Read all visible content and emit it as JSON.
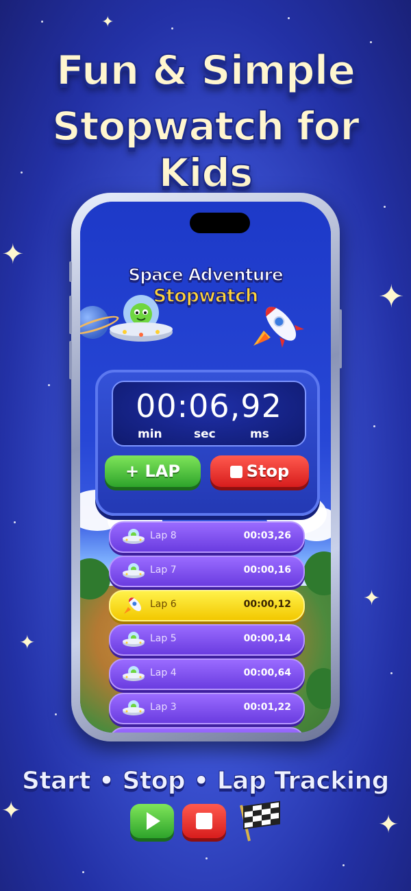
{
  "headline": {
    "line1": "Fun & Simple",
    "line2": "Stopwatch for Kids"
  },
  "app": {
    "title_line1": "Space Adventure",
    "title_line2": "Stopwatch"
  },
  "timer": {
    "display": "00:06,92",
    "units": [
      "min",
      "sec",
      "ms"
    ]
  },
  "buttons": {
    "lap_label": "+ LAP",
    "stop_label": "Stop"
  },
  "laps": [
    {
      "name": "Lap 8",
      "time": "00:03,26",
      "icon": "ufo-icon",
      "highlight": false
    },
    {
      "name": "Lap 7",
      "time": "00:00,16",
      "icon": "ufo-icon",
      "highlight": false
    },
    {
      "name": "Lap 6",
      "time": "00:00,12",
      "icon": "rocket-icon",
      "highlight": true
    },
    {
      "name": "Lap 5",
      "time": "00:00,14",
      "icon": "ufo-icon",
      "highlight": false
    },
    {
      "name": "Lap 4",
      "time": "00:00,64",
      "icon": "ufo-icon",
      "highlight": false
    },
    {
      "name": "Lap 3",
      "time": "00:01,22",
      "icon": "ufo-icon",
      "highlight": false
    }
  ],
  "features": "Start • Stop • Lap Tracking",
  "feature_icons": [
    "play-icon",
    "stop-icon",
    "checkered-flag-icon"
  ],
  "colors": {
    "lap_purple": "#7b4cf0",
    "lap_highlight": "#f7d21a",
    "lap_button": "#3cb935",
    "stop_button": "#e52a25",
    "title_yellow": "#ffd43a"
  }
}
